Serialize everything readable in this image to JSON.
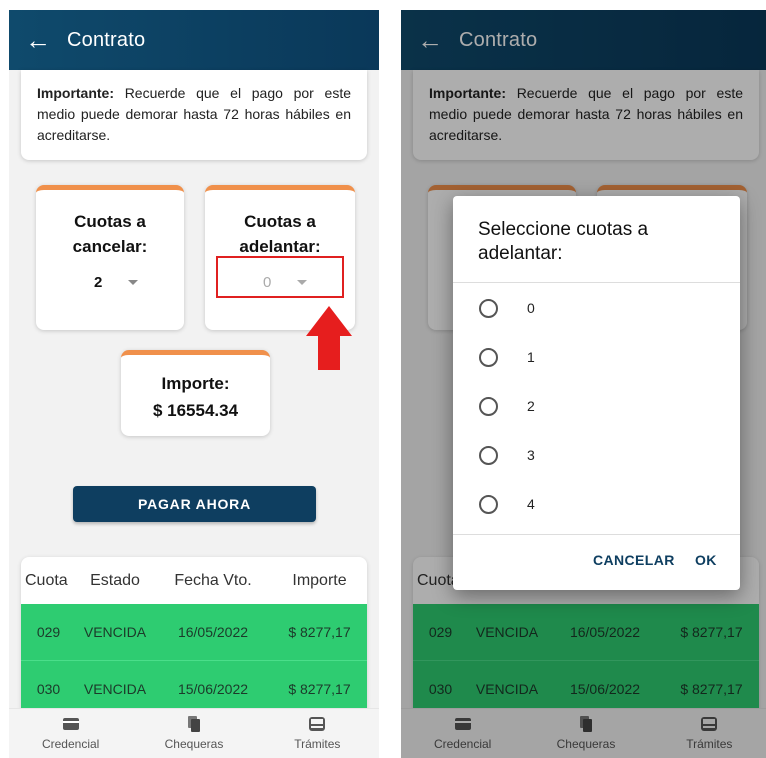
{
  "appbar": {
    "back_icon": "arrow-left-icon",
    "title": "Contrato"
  },
  "notice": {
    "bold": "Importante:",
    "text": " Recuerde que el pago por este medio puede demorar hasta 72 horas hábiles en acreditarse."
  },
  "cuotas_cancelar": {
    "label_line1": "Cuotas a",
    "label_line2": "cancelar:",
    "value": "2"
  },
  "cuotas_adelantar": {
    "label_line1": "Cuotas a",
    "label_line2": "adelantar:",
    "value": "0"
  },
  "importe": {
    "label": "Importe:",
    "value": "$ 16554.34"
  },
  "pay_button": "PAGAR AHORA",
  "table": {
    "headers": [
      "Cuota",
      "Estado",
      "Fecha Vto.",
      "Importe"
    ],
    "rows": [
      [
        "029",
        "VENCIDA",
        "16/05/2022",
        "$ 8277,17"
      ],
      [
        "030",
        "VENCIDA",
        "15/06/2022",
        "$ 8277,17"
      ]
    ]
  },
  "bottom_nav": [
    {
      "label": "Credencial",
      "icon": "credit-card-icon"
    },
    {
      "label": "Chequeras",
      "icon": "documents-icon"
    },
    {
      "label": "Trámites",
      "icon": "inbox-icon"
    }
  ],
  "dialog": {
    "title": "Seleccione cuotas a adelantar:",
    "options": [
      "0",
      "1",
      "2",
      "3",
      "4"
    ],
    "cancel": "CANCELAR",
    "ok": "OK"
  },
  "colors": {
    "appbar": "#0f4a6c",
    "accent_orange": "#f0904b",
    "row_green": "#2ecc71",
    "button": "#0e3e60",
    "highlight_red": "#e02020"
  }
}
